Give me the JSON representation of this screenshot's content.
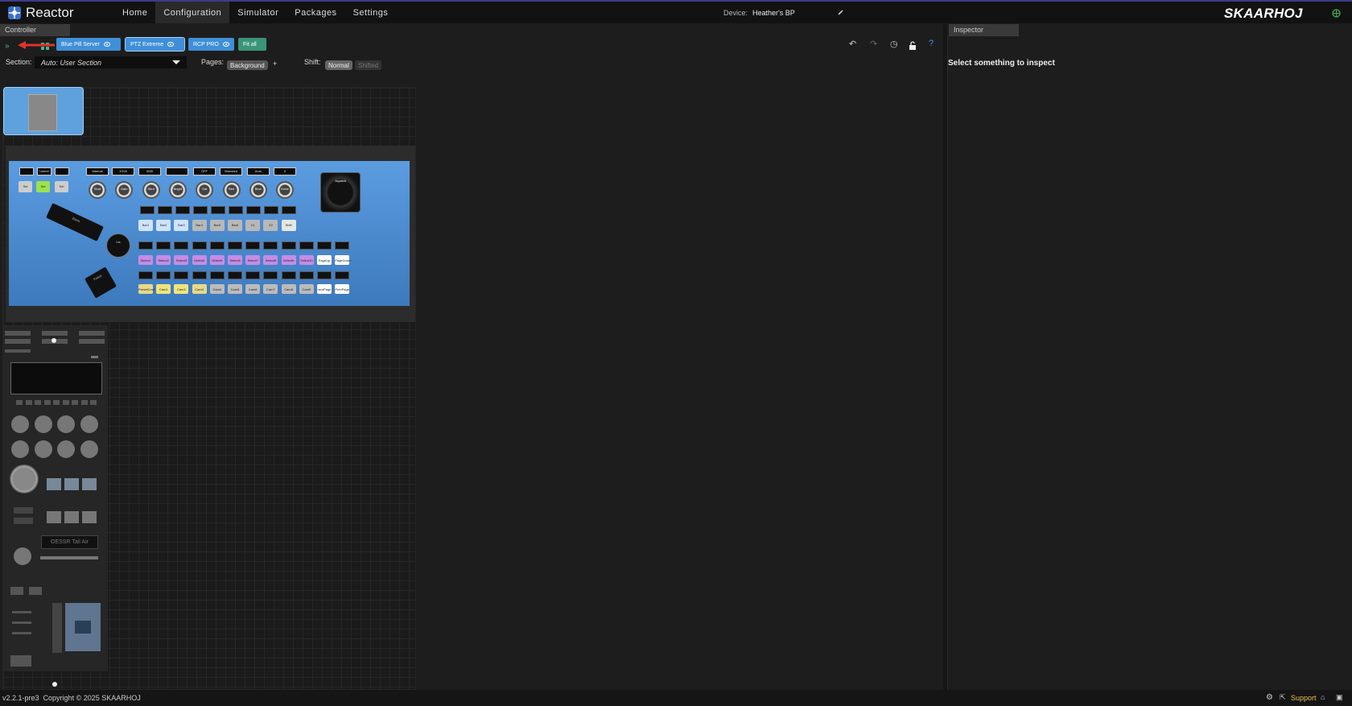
{
  "app": {
    "name": "Reactor",
    "brand": "SKAARHOJ"
  },
  "nav": {
    "items": [
      "Home",
      "Configuration",
      "Simulator",
      "Packages",
      "Settings"
    ],
    "active": "Configuration"
  },
  "device": {
    "label": "Device:",
    "name": "Heather's BP"
  },
  "controller_panel": {
    "title": "Controller"
  },
  "inspector_panel": {
    "title": "Inspector",
    "message": "Select something to inspect"
  },
  "toolbar": {
    "buttons": [
      {
        "label": "Blue Pill Server",
        "style": "blue"
      },
      {
        "label": "PTZ Extreme",
        "style": "blue-selected"
      },
      {
        "label": "RCP PRO",
        "style": "blue"
      },
      {
        "label": "Fit all",
        "style": "teal"
      }
    ]
  },
  "section": {
    "label": "Section:",
    "value": "Auto: User Section"
  },
  "pages": {
    "label": "Pages:",
    "value": "Background",
    "add": "+"
  },
  "shift": {
    "label": "Shift:",
    "options": [
      "Normal",
      "Shifted"
    ],
    "selected": "Normal"
  },
  "panel_main": {
    "top_displays": [
      "",
      "Userid",
      "",
      "Manual",
      "1/100",
      "5M8",
      "",
      "OFF",
      "Standard",
      "Auto",
      "0"
    ],
    "knobs": [
      "Shut",
      "Gain",
      "Shut",
      "Bright",
      "Sat",
      "Red",
      "Blue",
      "Knee"
    ],
    "keys_row1": [
      "Bar1",
      "Bar2",
      "Bar3",
      "Bar4",
      "Bar5",
      "Bar6",
      "X1",
      "X2",
      "Shift"
    ],
    "select_row": [
      "Select1",
      "Select2",
      "Select3",
      "Select4",
      "Select5",
      "Select6",
      "Select7",
      "Select8",
      "Select9",
      "Select10",
      "PageUp",
      "PageDown"
    ],
    "cam_row": [
      "PresetCmd",
      "Cam1",
      "Cam2",
      "Cam3",
      "Cam4",
      "Cam5",
      "Cam6",
      "Cam7",
      "Cam8",
      "Cam9",
      "nextPage",
      "PrevPage"
    ],
    "joystick_label": "Joystick",
    "zoom_label": "Zoom",
    "iris_label": "Iris",
    "focus_label": "Focus",
    "side_keys": [
      "Sel",
      "Sel",
      "Sel"
    ]
  },
  "panel_left": {
    "display_text": "OESSR Tail Air"
  },
  "status": {
    "version": "v2.2.1-pre3",
    "copyright": "Copyright © 2025 SKAARHOJ",
    "support": "Support"
  }
}
